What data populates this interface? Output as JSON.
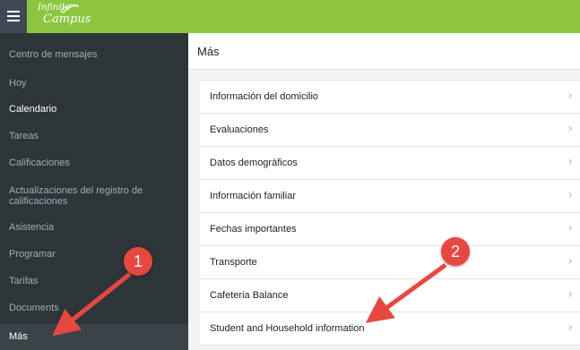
{
  "app": {
    "logo_line1": "Infinite",
    "logo_line2": "Campus"
  },
  "sidebar": {
    "items": [
      {
        "label": "Centro de mensajes"
      },
      {
        "label": "Hoy"
      },
      {
        "label": "Calendario"
      },
      {
        "label": "Tareas"
      },
      {
        "label": "Calificaciones"
      },
      {
        "label": "Actualizaciones del registro de calificaciones"
      },
      {
        "label": "Asistencia"
      },
      {
        "label": "Programar"
      },
      {
        "label": "Tarifas"
      },
      {
        "label": "Documents"
      },
      {
        "label": "Más"
      }
    ]
  },
  "main": {
    "title": "Más",
    "items": [
      {
        "label": "Información del domicilio"
      },
      {
        "label": "Evaluaciones"
      },
      {
        "label": "Datos demográficos"
      },
      {
        "label": "Información familiar"
      },
      {
        "label": "Fechas importantes"
      },
      {
        "label": "Transporte"
      },
      {
        "label": "Cafeteria Balance"
      },
      {
        "label": "Student and Household information"
      }
    ]
  },
  "callouts": {
    "first": "1",
    "second": "2"
  },
  "colors": {
    "topbar": "#8cc63f",
    "sidebar": "#2e3539",
    "callout": "#e8473f"
  },
  "icons": {
    "menu": "hamburger-icon",
    "chevron": "chevron-right-icon"
  }
}
